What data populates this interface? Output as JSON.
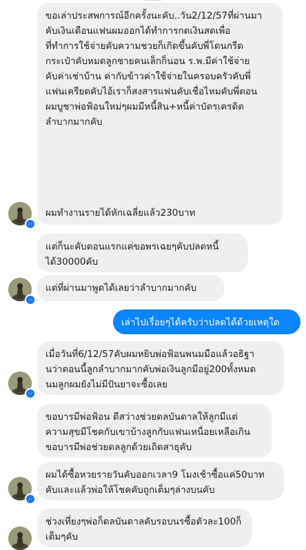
{
  "messages": [
    {
      "dir": "in",
      "text": "ขอเล่าประสพการณ์อีกครั้งนะคับ..วัน2/12/57ที่ผ่านมา\nคับเงินเดือนแฟนผมออกได้ทำการกดเงินสดเพื่อ\nที่ทำการใช้จ่ายคับความชวยก็เกิดขึ้นคับพี่โดนกรีด\nกระเป๋าคับหมดลูกชายคนเล็กก็นอน ร.พ.มีค่าใช้จ่าย\nคับค่าเช่าบ้าน ค่ากับข้าวค่าใช้จ่ายในครอบครัวคับพี่\nแฟนเครียดคับไอ้เราก็สงสารแฟนคับเชื่อไหมคับพี่ตอน\nผมบูชาพ่อฟ้อนใหม่ๆผมมีหนี้สิน+หนี้ค่าบัตรเครดิต\nลำบากมากคับ\n\n\n\n\n\nผมทำงานรายได้หักเฉลี่ยแล้ว230บาท"
    },
    {
      "dir": "in",
      "text": "แต่ก็นะคับตอนแรกแค่ขอพรเฉยๆคับปลดหนี้\nได้30000คับ"
    },
    {
      "dir": "in",
      "text": "แต่ที่ผ่านมาพูดได้เลยว่าลำบากมากคับ"
    },
    {
      "dir": "out",
      "text": "เล่าไปเรื่อยๆได้ครับว่าปลดได้ด้วยเหตุใด"
    },
    {
      "dir": "in",
      "text": "เมื่อวันที่6/12/57คับผมหยิบพ่อฟ้อนพนมมือแล้วอธิฐา\nนว่าตอนนี้ลูกลำบากมากคับพ่อเงินลูกมีอยู่200ทั้งหมด\nนมลูกผมยังไม่มีปันยาจะซื้อเลย"
    },
    {
      "dir": "in",
      "text": "ขอบารมีพ่อฟ้อน ดีสว่างช่วยดลบันดาลให้ลูกมีแต่\nความสุขมีโชคกับเขาบ้างลูกกับแฟนเหนื่อยเหลือเกิน\nขอบารมีพ่อช่วยดลลูกด้วยเถิดสาธุคับ"
    },
    {
      "dir": "in",
      "text": "ผมได้ซื้อหวยรายวันคับออกเวลา9 โมงเช้าซื้อแค่50บาท\nคับและแล้วพ่อให้โชคคับถูกเต็มๆล่างบนคับ"
    },
    {
      "dir": "in",
      "text": "ช่วงเที่ยงๆพ่อก็ดลบันดาลคับรอบนรซื้อตัวละ100ก็\nเต็มๆคับ"
    }
  ],
  "colors": {
    "incoming_bubble": "#eeeff1",
    "outgoing_bubble": "#0a84ff",
    "badge": "#1877f2"
  },
  "icons": {
    "avatar": "buddha-statue-avatar",
    "badge": "messenger-badge-icon"
  }
}
